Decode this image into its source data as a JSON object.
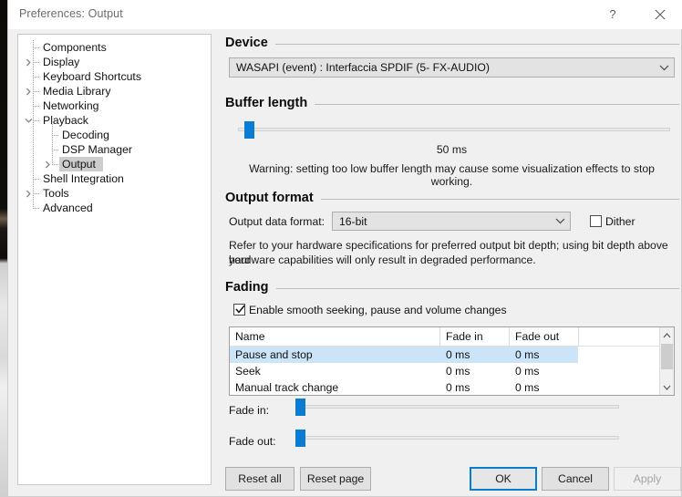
{
  "window": {
    "title": "Preferences: Output",
    "help_icon": "question-mark-icon",
    "close_icon": "close-icon"
  },
  "sidebar": {
    "items": [
      {
        "label": "Components",
        "level": 1,
        "arrow": "none",
        "selected": false
      },
      {
        "label": "Display",
        "level": 1,
        "arrow": "collapsed",
        "selected": false
      },
      {
        "label": "Keyboard Shortcuts",
        "level": 1,
        "arrow": "none",
        "selected": false
      },
      {
        "label": "Media Library",
        "level": 1,
        "arrow": "collapsed",
        "selected": false
      },
      {
        "label": "Networking",
        "level": 1,
        "arrow": "none",
        "selected": false
      },
      {
        "label": "Playback",
        "level": 1,
        "arrow": "expanded",
        "selected": false
      },
      {
        "label": "Decoding",
        "level": 2,
        "arrow": "none",
        "selected": false
      },
      {
        "label": "DSP Manager",
        "level": 2,
        "arrow": "none",
        "selected": false
      },
      {
        "label": "Output",
        "level": 2,
        "arrow": "collapsed",
        "selected": true
      },
      {
        "label": "Shell Integration",
        "level": 1,
        "arrow": "none",
        "selected": false
      },
      {
        "label": "Tools",
        "level": 1,
        "arrow": "collapsed",
        "selected": false
      },
      {
        "label": "Advanced",
        "level": 1,
        "arrow": "none",
        "selected": false
      }
    ]
  },
  "device": {
    "section_title": "Device",
    "selected": "WASAPI (event) : Interfaccia SPDIF (5- FX-AUDIO)"
  },
  "buffer": {
    "section_title": "Buffer length",
    "value_label": "50 ms",
    "warning": "Warning: setting too low buffer length may cause some visualization effects to stop working.",
    "slider_percent": 2
  },
  "output_format": {
    "section_title": "Output format",
    "field_label": "Output data format:",
    "selected": "16-bit",
    "dither_label": "Dither",
    "dither_checked": false,
    "note_line1": "Refer to your hardware specifications for preferred output bit depth; using bit depth above your",
    "note_line2": "hardware capabilities will only result in degraded performance."
  },
  "fading": {
    "section_title": "Fading",
    "enable_label": "Enable smooth seeking, pause and volume changes",
    "enable_checked": true,
    "columns": [
      "Name",
      "Fade in",
      "Fade out"
    ],
    "rows": [
      {
        "name": "Pause and stop",
        "fade_in": "0 ms",
        "fade_out": "0 ms",
        "selected": true
      },
      {
        "name": "Seek",
        "fade_in": "0 ms",
        "fade_out": "0 ms",
        "selected": false
      },
      {
        "name": "Manual track change",
        "fade_in": "0 ms",
        "fade_out": "0 ms",
        "selected": false
      }
    ],
    "fade_in_label": "Fade in:",
    "fade_out_label": "Fade out:",
    "fade_in_percent": 1,
    "fade_out_percent": 1
  },
  "footer": {
    "reset_all": "Reset all",
    "reset_page": "Reset page",
    "ok": "OK",
    "cancel": "Cancel",
    "apply": "Apply",
    "apply_enabled": false
  },
  "colors": {
    "accent": "#0a7cd1",
    "selection": "#cce4f7",
    "tree_selection": "#cdcdcd",
    "dialog_bg": "#f0f0f0"
  }
}
